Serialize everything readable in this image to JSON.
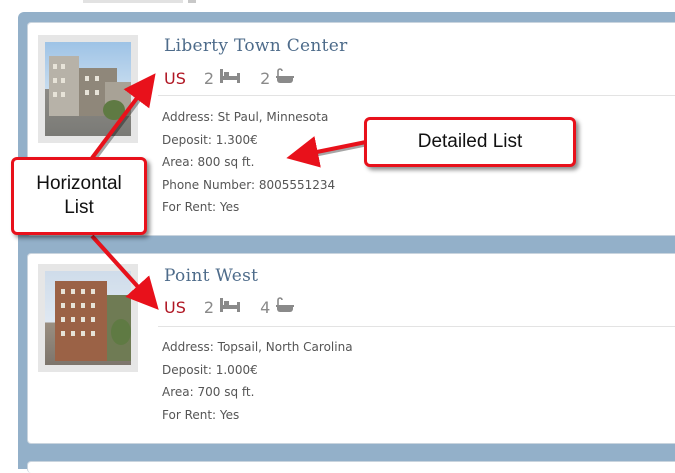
{
  "listings": [
    {
      "title": "Liberty Town Center",
      "country": "US",
      "bedrooms": "2",
      "bathrooms": "2",
      "details": [
        "Address: St Paul, Minnesota",
        "Deposit: 1.300€",
        "Area: 800 sq ft.",
        "Phone Number: 8005551234",
        "For Rent: Yes"
      ]
    },
    {
      "title": "Point West",
      "country": "US",
      "bedrooms": "2",
      "bathrooms": "4",
      "details": [
        "Address: Topsail, North Carolina",
        "Deposit: 1.000€",
        "Area: 700 sq ft.",
        "For Rent: Yes"
      ]
    }
  ],
  "callouts": {
    "detailed": "Detailed List",
    "horizontal_line1": "Horizontal",
    "horizontal_line2": "List"
  },
  "icons": {
    "bed": "bed-icon",
    "bath": "bath-icon"
  },
  "colors": {
    "country": "#b01623",
    "title": "#4d6b8a",
    "panel": "#93b0c9",
    "callout_border": "#e8111b"
  }
}
